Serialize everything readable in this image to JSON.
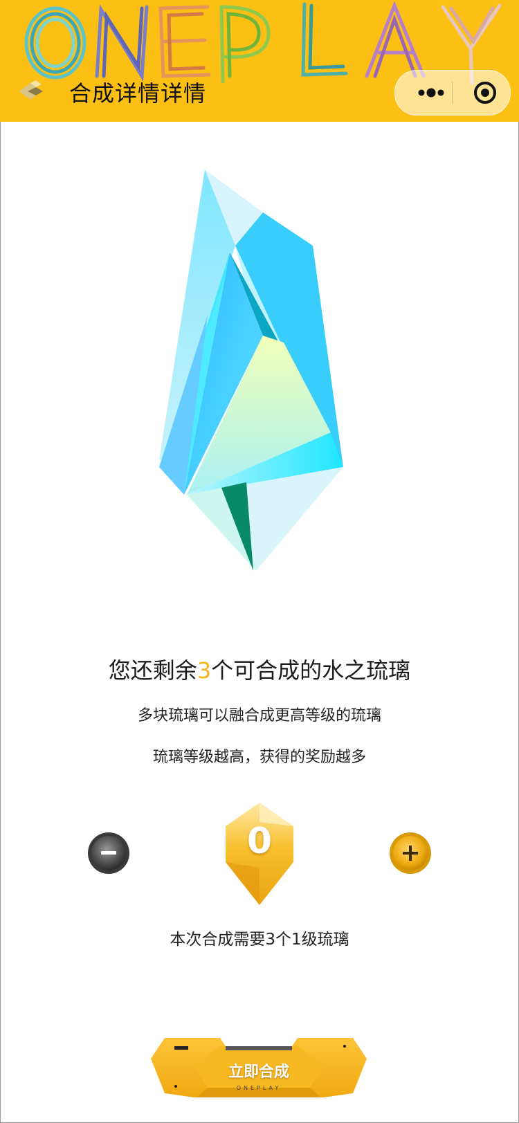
{
  "header": {
    "brand_text": "ONEPLAY",
    "title": "合成详情详情",
    "back_icon": "back-chevron-icon",
    "more_icon": "more-dots-icon",
    "close_icon": "close-target-icon"
  },
  "main": {
    "headline_prefix": "您还剩余",
    "headline_count": "3",
    "headline_suffix": "个可合成的水之琉璃",
    "desc_line1": "多块琉璃可以融合成更高等级的琉璃",
    "desc_line2": "琉璃等级越高，获得的奖励越多"
  },
  "stepper": {
    "value": "0",
    "minus_icon": "minus-icon",
    "plus_icon": "plus-icon"
  },
  "requirement": "本次合成需要3个1级琉璃",
  "action": {
    "label": "立即合成",
    "sub_label": "ONEPLAY"
  },
  "colors": {
    "brand_yellow": "#fcc015",
    "accent_number": "#f4b31b",
    "crystal_blue": "#38cdfa"
  }
}
